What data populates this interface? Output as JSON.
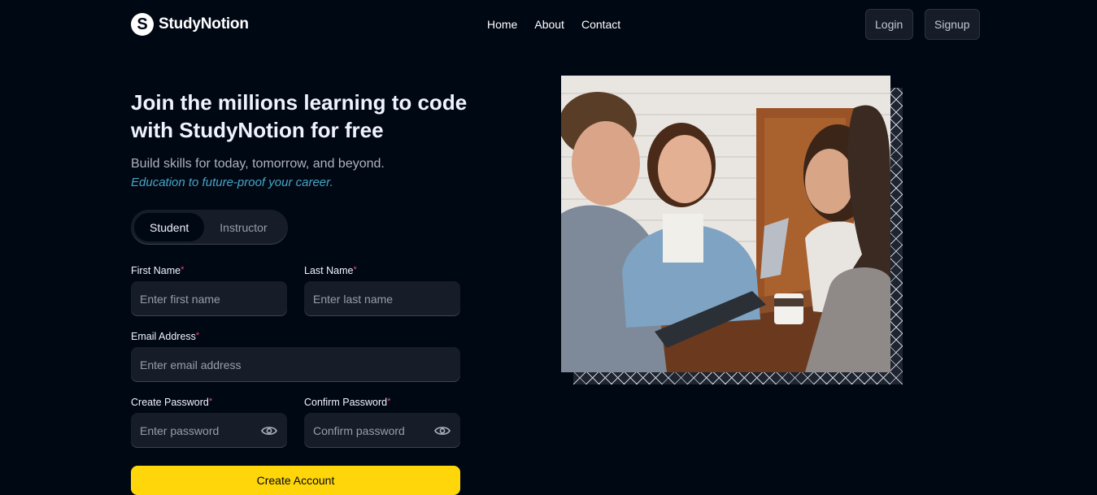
{
  "brand": {
    "name": "StudyNotion",
    "logo_letter": "S"
  },
  "nav": {
    "links": [
      "Home",
      "About",
      "Contact"
    ],
    "login": "Login",
    "signup": "Signup"
  },
  "hero": {
    "headline": "Join the millions learning to code with StudyNotion for free",
    "subtitle": "Build skills for today, tomorrow, and beyond.",
    "tagline": "Education to future-proof your career."
  },
  "role_toggle": {
    "options": [
      "Student",
      "Instructor"
    ],
    "selected": "Student"
  },
  "form": {
    "first_name": {
      "label": "First Name",
      "placeholder": "Enter first name"
    },
    "last_name": {
      "label": "Last Name",
      "placeholder": "Enter last name"
    },
    "email": {
      "label": "Email Address",
      "placeholder": "Enter email address"
    },
    "password": {
      "label": "Create Password",
      "placeholder": "Enter password"
    },
    "confirm_password": {
      "label": "Confirm Password",
      "placeholder": "Confirm password"
    },
    "required_mark": "*",
    "submit": "Create Account"
  },
  "colors": {
    "background": "#000814",
    "field_bg": "#161D29",
    "accent_yellow": "#FFD60A",
    "accent_blue": "#47A5C5",
    "required_red": "#EF476F"
  },
  "icons": [
    "logo-icon",
    "eye-icon"
  ]
}
